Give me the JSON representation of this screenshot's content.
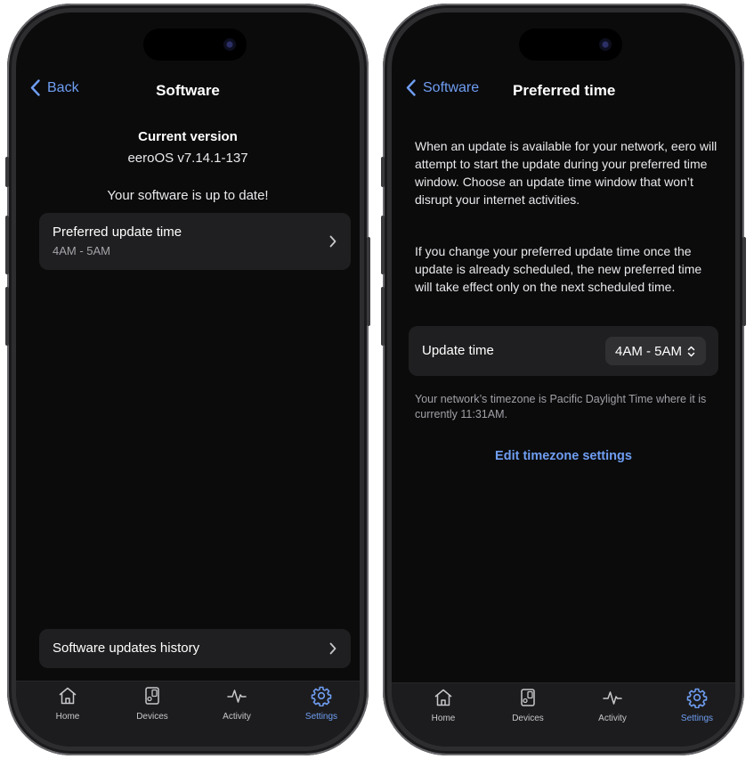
{
  "left_screen": {
    "nav": {
      "back_label": "Back",
      "title": "Software"
    },
    "version": {
      "heading": "Current version",
      "value": "eeroOS v7.14.1-137"
    },
    "status_message": "Your software is up to date!",
    "preferred_card": {
      "title": "Preferred update time",
      "value": "4AM - 5AM"
    },
    "history_card": {
      "title": "Software updates history"
    }
  },
  "right_screen": {
    "nav": {
      "back_label": "Software",
      "title": "Preferred time"
    },
    "description_1": "When an update is available for your network, eero will attempt to start the update during your preferred time window. Choose an update time window that won’t disrupt your internet activities.",
    "description_2": "If you change your preferred update time once the update is already scheduled, the new preferred time will take effect only on the next scheduled time.",
    "update_time": {
      "label": "Update time",
      "value": "4AM - 5AM"
    },
    "timezone_note": "Your network’s timezone is Pacific Daylight Time where it is currently 11:31AM.",
    "timezone_link": "Edit timezone settings"
  },
  "tab_bar": {
    "tabs": [
      {
        "label": "Home",
        "icon": "home-icon",
        "active": false
      },
      {
        "label": "Devices",
        "icon": "devices-icon",
        "active": false
      },
      {
        "label": "Activity",
        "icon": "activity-icon",
        "active": false
      },
      {
        "label": "Settings",
        "icon": "gear-icon",
        "active": true
      }
    ]
  },
  "colors": {
    "accent": "#6f9ef2",
    "background": "#0b0b0c",
    "card": "#1f1f21",
    "tab_bar": "#1c1c1e",
    "secondary_text": "#a5a5aa"
  }
}
